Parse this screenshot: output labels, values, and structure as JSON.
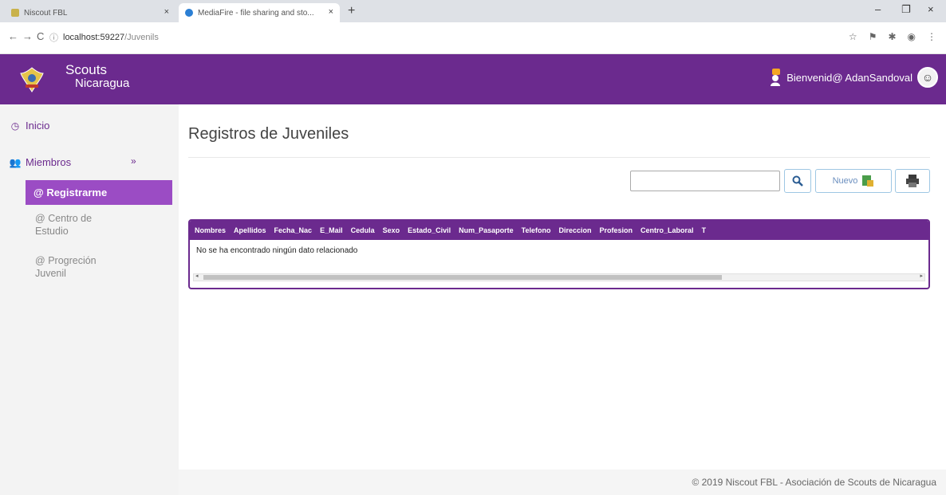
{
  "browser": {
    "tabs": [
      {
        "title": "Niscout FBL",
        "close": "×"
      },
      {
        "title": "MediaFire - file sharing and sto...",
        "close": "×"
      }
    ],
    "new_tab": "+",
    "window_controls": {
      "minimize": "–",
      "maximize": "❐",
      "close": "×"
    },
    "nav": {
      "back": "←",
      "forward": "→",
      "reload": "C"
    },
    "url": {
      "host": "localhost:59227",
      "path": "/Juvenils"
    }
  },
  "header": {
    "brand_line1": "Scouts",
    "brand_line2": "Nicaragua",
    "welcome": "Bienvenid@ AdanSandoval"
  },
  "sidebar": {
    "inicio": "Inicio",
    "miembros": "Miembros",
    "miembros_chevron": "»",
    "registrarme": "Registrarme",
    "centro_line1": "Centro de",
    "centro_line2": "Estudio",
    "progresion_line1": "Progreción",
    "progresion_line2": "Juvenil",
    "sub_icon": "@"
  },
  "main": {
    "title": "Registros de Juveniles",
    "search_placeholder": "",
    "new_button": "Nuevo",
    "table_headers": [
      "Nombres",
      "Apellidos",
      "Fecha_Nac",
      "E_Mail",
      "Cedula",
      "Sexo",
      "Estado_Civil",
      "Num_Pasaporte",
      "Telefono",
      "Direccion",
      "Profesion",
      "Centro_Laboral",
      "T"
    ],
    "empty_message": "No se ha encontrado ningún dato relacionado"
  },
  "footer": {
    "text": "© 2019 Niscout FBL - Asociación de Scouts de Nicaragua"
  },
  "colors": {
    "primary": "#6b2a8e",
    "active_menu": "#9b4cc4"
  }
}
